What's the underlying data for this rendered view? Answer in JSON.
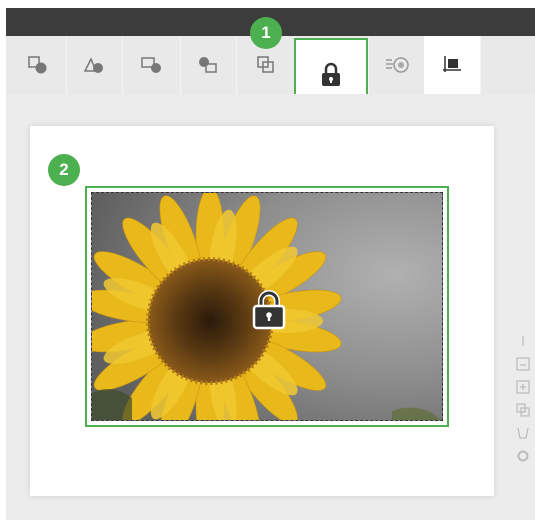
{
  "toolbar": {
    "tools": [
      {
        "name": "bring-forward-tool",
        "icon": "bring-forward-icon"
      },
      {
        "name": "shape-tool",
        "icon": "shapes-icon"
      },
      {
        "name": "send-backward-tool",
        "icon": "send-backward-icon"
      },
      {
        "name": "group-tool",
        "icon": "group-icon"
      },
      {
        "name": "duplicate-tool",
        "icon": "duplicate-icon"
      },
      {
        "name": "lock-tool",
        "icon": "lock-icon",
        "active": true
      },
      {
        "name": "animation-tool",
        "icon": "animation-icon"
      },
      {
        "name": "crop-tool",
        "icon": "crop-icon"
      }
    ]
  },
  "callouts": {
    "step1": "1",
    "step2": "2"
  },
  "canvas": {
    "image_subject": "sunflower",
    "locked": true
  },
  "colors": {
    "accent": "#4caf50",
    "topbar": "#3c3c3c",
    "toolbar": "#e9e9e9",
    "workspace": "#ececec"
  },
  "side_tools": [
    "layers-icon",
    "align-down-icon",
    "align-up-icon",
    "copy-icon",
    "paint-bucket-icon",
    "settings-icon"
  ]
}
